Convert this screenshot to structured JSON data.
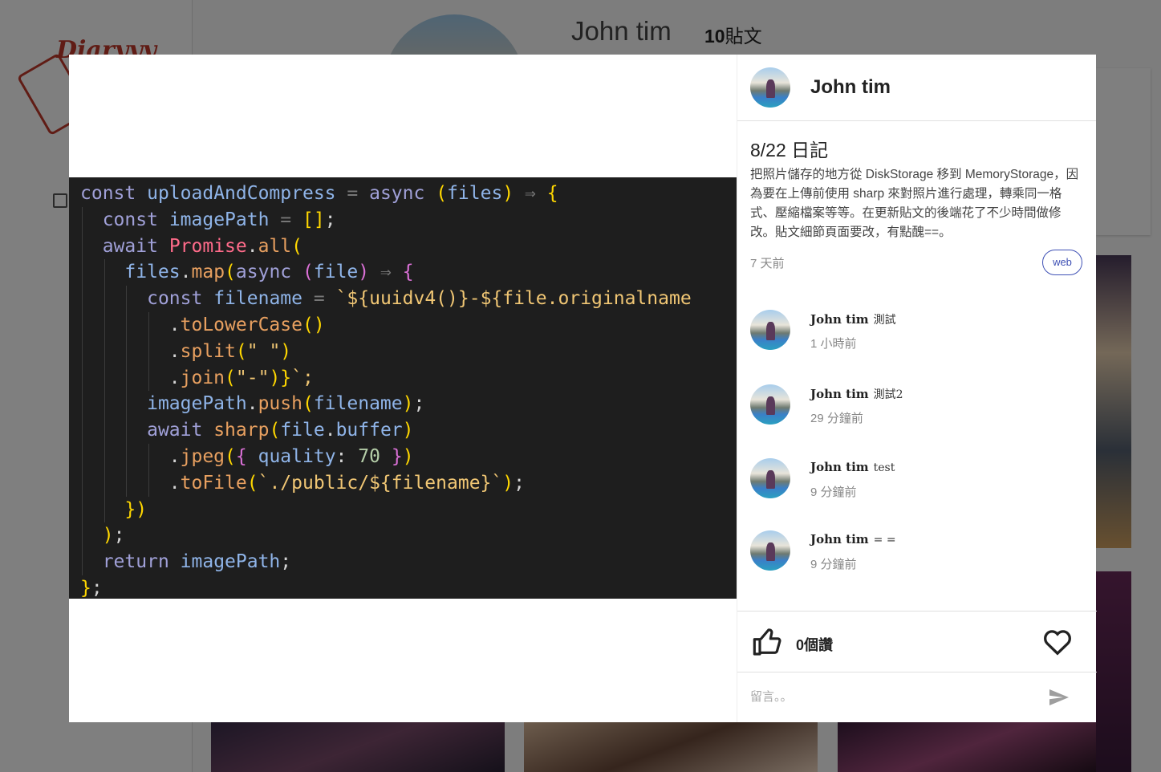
{
  "background": {
    "logo_text": "Diaryyy",
    "profile_name": "John tim",
    "post_count": "10",
    "post_count_label": "貼文"
  },
  "post_image": {
    "code_lines": [
      "const uploadAndCompress = async (files) ⇒ {",
      "  const imagePath = [];",
      "  await Promise.all(",
      "    files.map(async (file) ⇒ {",
      "      const filename = `${uuidv4()}-${file.originalname",
      "        .toLowerCase()",
      "        .split(\" \")",
      "        .join(\"-\")}`;",
      "      imagePath.push(filename);",
      "      await sharp(file.buffer)",
      "        .jpeg({ quality: 70 })",
      "        .toFile(`./public/${filename}`);",
      "    })",
      "  );",
      "  return imagePath;",
      "};"
    ]
  },
  "post": {
    "author": "John tim",
    "title": "8/22 日記",
    "body": "把照片儲存的地方從 DiskStorage 移到 MemoryStorage，因為要在上傳前使用 sharp 來對照片進行處理，轉乘同一格式、壓縮檔案等等。在更新貼文的後端花了不少時間做修改。貼文細節頁面要改，有點醜==。",
    "time": "7 天前",
    "tag": "web"
  },
  "comments": [
    {
      "user": "John tim",
      "text": "測試",
      "time": "1 小時前"
    },
    {
      "user": "John tim",
      "text": "測試2",
      "time": "29 分鐘前"
    },
    {
      "user": "John tim",
      "text": "test",
      "time": "9 分鐘前"
    },
    {
      "user": "John tim",
      "text": "= =",
      "time": "9 分鐘前"
    }
  ],
  "actions": {
    "likes_label": "0個讚"
  },
  "comment_box": {
    "placeholder": "留言。。"
  },
  "icons": {
    "like": "thumb-up-icon",
    "heart": "heart-outline-icon",
    "send": "send-icon",
    "list": "list-icon"
  }
}
